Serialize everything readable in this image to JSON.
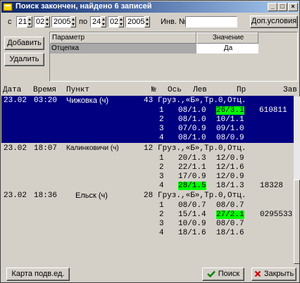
{
  "window": {
    "title": "Поиск закончен, найдено 6 записей"
  },
  "filter": {
    "from_label": "с",
    "from_day": "21",
    "from_month": "02",
    "from_year": "2005",
    "to_label": "по",
    "to_day": "24",
    "to_month": "02",
    "to_year": "2005",
    "inv_label": "Инв. №",
    "inv_value": "",
    "extra_button": "Доп.условия"
  },
  "params": {
    "add_button": "Добавить",
    "delete_button": "Удалить",
    "headers": {
      "param": "Параметр",
      "value": "Значение"
    },
    "rows": [
      {
        "param": "Отцепка",
        "value": "Да"
      }
    ]
  },
  "grid": {
    "headers": {
      "date": "Дата",
      "time": "Время",
      "point": "Пункт",
      "no": "№",
      "axis": "Ось",
      "left": "Лев",
      "right": "Пр",
      "plant": "Зав"
    },
    "records": [
      {
        "date": "23.02",
        "time": "03:20",
        "point": "Чижовка (ч)",
        "no": "43",
        "summary": "Груз.,«Б»,Тр.0,Отц.",
        "plant": "610811",
        "axes": [
          {
            "n": "1",
            "left": "08/1.0",
            "right": "26/3.1"
          },
          {
            "n": "2",
            "left": "08/1.0",
            "right": "10/1.1"
          },
          {
            "n": "3",
            "left": "07/0.9",
            "right": "09/1.0"
          },
          {
            "n": "4",
            "left": "08/1.0",
            "right": "08/0.9"
          }
        ]
      },
      {
        "date": "23.02",
        "time": "18:07",
        "point": "Калинковичи (ч)",
        "no": "12",
        "summary": "Груз.,«Б»,Тр.0,Отц.",
        "plant": "18328",
        "axes": [
          {
            "n": "1",
            "left": "20/1.3",
            "right": "12/0.9"
          },
          {
            "n": "2",
            "left": "22/1.1",
            "right": "12/1.6"
          },
          {
            "n": "3",
            "left": "17/0.9",
            "right": "12/0.9"
          },
          {
            "n": "4",
            "left": "28/1.5",
            "right": "18/1.3"
          }
        ]
      },
      {
        "date": "23.02",
        "time": "18:36",
        "point": "Ельск (ч)",
        "no": "28",
        "summary": "Груз.,«Б»,Тр.0,Отц.",
        "plant": "0295533",
        "axes": [
          {
            "n": "1",
            "left": "08/0.7",
            "right": "08/0.7"
          },
          {
            "n": "2",
            "left": "15/1.4",
            "right": "27/2.1"
          },
          {
            "n": "3",
            "left": "10/0.9",
            "right": "08/0.7"
          },
          {
            "n": "4",
            "left": "18/1.6",
            "right": "18/1.6"
          }
        ]
      }
    ]
  },
  "footer": {
    "card_button": "Карта подв.ед.",
    "search_button": "Поиск",
    "close_button": "Закрыть"
  },
  "colors": {
    "selection": "#000080",
    "highlight": "#00ff00",
    "titlebar": "#0a246a"
  }
}
